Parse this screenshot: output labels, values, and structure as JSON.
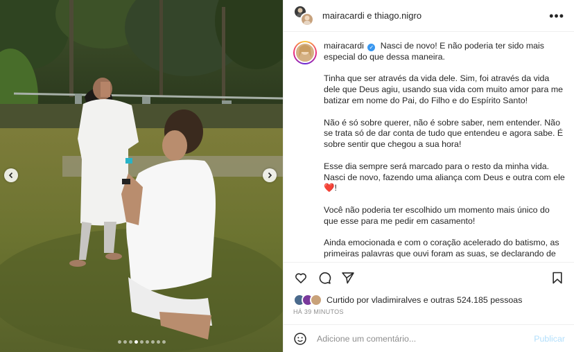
{
  "header": {
    "title": "mairacardi e thiago.nigro",
    "more_icon": "more-horizontal-icon"
  },
  "carousel": {
    "slide_count": 9,
    "active_index": 3,
    "prev_icon": "chevron-left-icon",
    "next_icon": "chevron-right-icon"
  },
  "caption": {
    "username": "mairacardi",
    "verified": true,
    "paragraphs": [
      "Nasci de novo! E não poderia ter sido mais especial do que dessa maneira.",
      "Tinha que ser através da vida dele. Sim, foi através da vida dele que Deus agiu, usando sua vida com muito amor para me batizar em nome do Pai, do Filho e do Espírito Santo!",
      "Não é só sobre querer, não é sobre saber, nem entender. Não se trata só de dar conta de tudo que entendeu e agora sabe. É sobre sentir que chegou a sua hora!",
      "Esse dia sempre será marcado para o resto da minha vida. Nasci de novo, fazendo uma aliança com Deus e outra com ele",
      "Você não poderia ter escolhido um momento mais único do que esse para me pedir em casamento!",
      "Ainda emocionada e com o coração acelerado do batismo, as primeiras palavras que ouvi foram as suas, se declarando de uma forma mágica e única que jamais vivi. Terminando"
    ],
    "heart_emoji": "❤️",
    "exclamation": "!"
  },
  "actions": {
    "like_icon": "heart-icon",
    "comment_icon": "comment-icon",
    "share_icon": "send-icon",
    "save_icon": "bookmark-icon"
  },
  "likes": {
    "text": "Curtido por vladimiralves e outras 524.185 pessoas"
  },
  "timestamp": "HÁ 39 MINUTOS",
  "comment_box": {
    "placeholder": "Adicione um comentário...",
    "publish_label": "Publicar",
    "emoji_icon": "smiley-icon"
  },
  "colors": {
    "verified": "#3897f0",
    "publish_disabled": "#b2dffc",
    "heart": "#ed1c3a"
  }
}
